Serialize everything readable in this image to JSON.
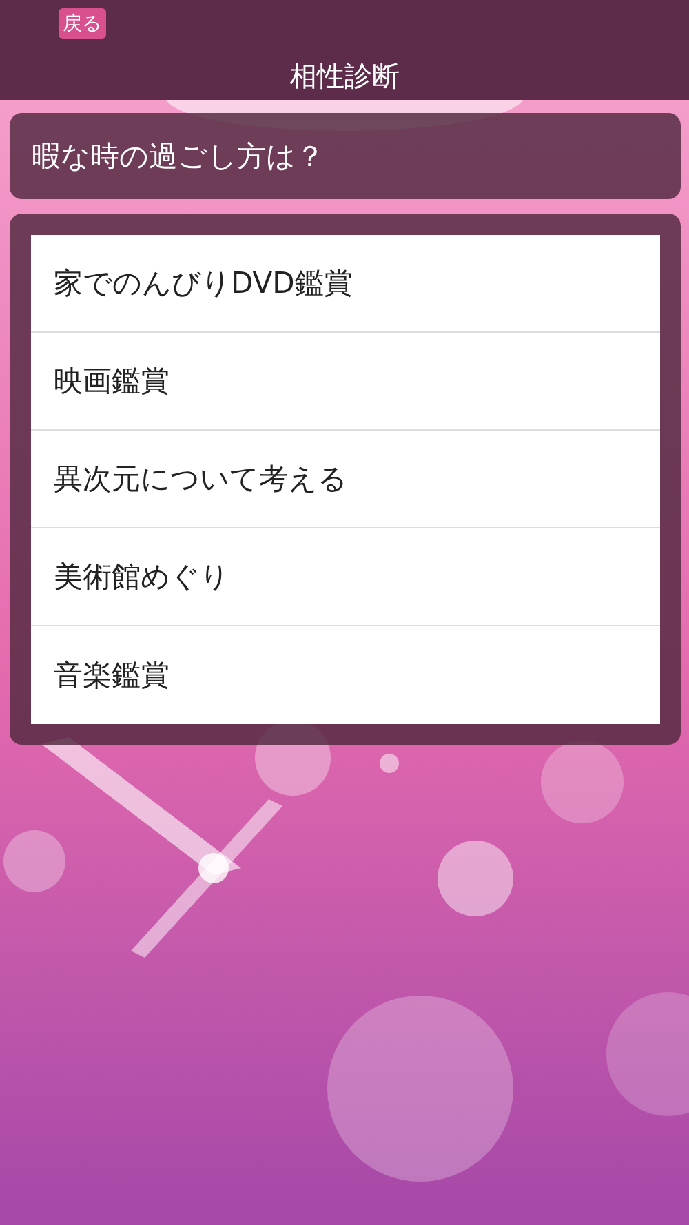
{
  "header": {
    "back_button": "戻る",
    "title": "相性診断"
  },
  "question": "暇な時の過ごし方は？",
  "options": [
    "家でのんびりDVD鑑賞",
    "映画鑑賞",
    "異次元について考える",
    "美術館めぐり",
    "音楽鑑賞"
  ]
}
